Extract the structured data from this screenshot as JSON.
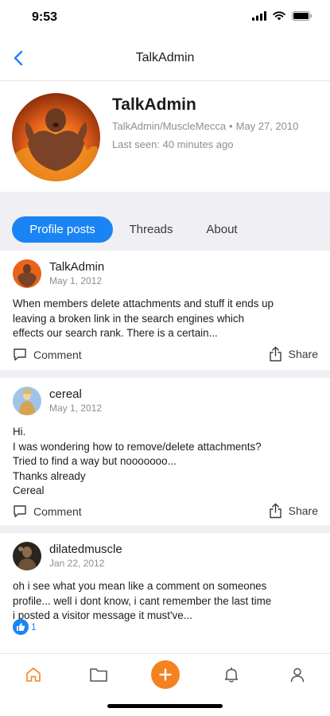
{
  "status_bar": {
    "time": "9:53",
    "icons": [
      "signal-icon",
      "wifi-icon",
      "battery-icon"
    ]
  },
  "nav": {
    "title": "TalkAdmin",
    "back_icon": "chevron-left-icon"
  },
  "profile": {
    "name": "TalkAdmin",
    "handle": "TalkAdmin/MuscleMecca",
    "joined": "May 27, 2010",
    "last_seen": "Last seen: 40 minutes ago"
  },
  "tabs": [
    {
      "label": "Profile posts",
      "active": true
    },
    {
      "label": "Threads",
      "active": false
    },
    {
      "label": "About",
      "active": false
    }
  ],
  "posts": [
    {
      "author": "TalkAdmin",
      "date": "May 1, 2012",
      "lines": [
        "When members delete attachments and stuff it ends up",
        "leaving a broken link in the search engines which",
        "effects our search rank. There is a certain..."
      ],
      "comment_label": "Comment",
      "share_label": "Share"
    },
    {
      "author": "cereal",
      "date": "May 1, 2012",
      "lines": [
        "Hi.",
        "I was wondering how to remove/delete attachments?",
        "Tried to find a way but nooooooo...",
        "Thanks already",
        "Cereal"
      ],
      "comment_label": "Comment",
      "share_label": "Share"
    },
    {
      "author": "dilatedmuscle",
      "date": "Jan 22, 2012",
      "lines": [
        "oh i see what you mean like a comment on someones",
        "profile... well i dont know, i cant remember the last time",
        "i posted a visitor message it must've..."
      ],
      "likes": "1"
    }
  ],
  "tab_bar": {
    "items": [
      "home-icon",
      "folder-icon",
      "plus-icon",
      "bell-icon",
      "person-icon"
    ],
    "active": "home-icon"
  },
  "colors": {
    "accent": "#1a84f5",
    "orange": "#f58220",
    "background_band": "#efeff4",
    "secondary_text": "#8e8e93"
  }
}
